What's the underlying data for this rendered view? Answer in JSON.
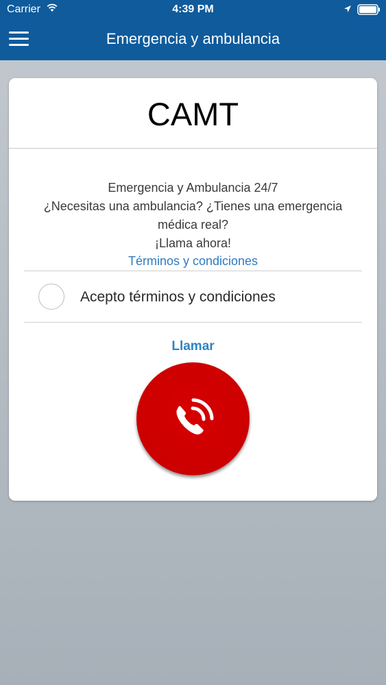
{
  "status_bar": {
    "carrier": "Carrier",
    "time": "4:39 PM",
    "icons": [
      "wifi-icon",
      "location-arrow-icon",
      "battery-icon"
    ]
  },
  "nav": {
    "menu_icon": "hamburger-menu-icon",
    "title": "Emergencia y ambulancia"
  },
  "card": {
    "title": "CAMT",
    "body_lines": [
      "Emergencia y Ambulancia 24/7",
      "¿Necesitas una ambulancia? ¿Tienes una emergencia",
      "médica real?",
      "¡Llama ahora!"
    ],
    "terms_link": "Términos y condiciones",
    "accept_label": "Acepto términos y condiciones",
    "accept_checked": false,
    "call_label": "Llamar",
    "call_icon": "phone-ringing-icon"
  },
  "colors": {
    "nav_background": "#0f5b9c",
    "link": "#2f7bbf",
    "call_button": "#cc0000",
    "page_background": "#a7b0b8"
  }
}
